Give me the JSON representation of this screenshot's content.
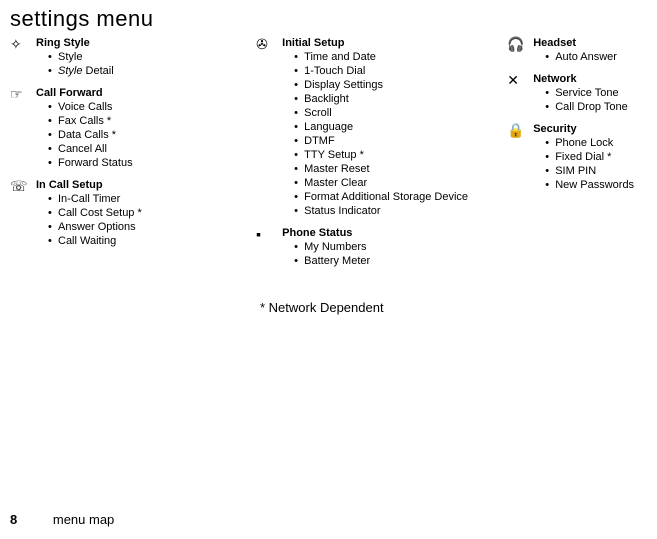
{
  "title": "settings menu",
  "footnote": "* Network Dependent",
  "footer": {
    "page": "8",
    "section": "menu map"
  },
  "columns": [
    {
      "sections": [
        {
          "icon": "✧",
          "icon_name": "ring-style-icon",
          "heading": "Ring Style",
          "items": [
            {
              "text": "Style"
            },
            {
              "prefix_italic": "Style",
              "suffix": " Detail"
            }
          ]
        },
        {
          "icon": "☞",
          "icon_name": "call-forward-icon",
          "heading": "Call Forward",
          "items": [
            {
              "text": "Voice Calls"
            },
            {
              "text": "Fax Calls *"
            },
            {
              "text": "Data Calls *"
            },
            {
              "text": "Cancel All"
            },
            {
              "text": "Forward Status"
            }
          ]
        },
        {
          "icon": "☏",
          "icon_name": "in-call-setup-icon",
          "heading": "In Call Setup",
          "items": [
            {
              "text": "In-Call Timer"
            },
            {
              "text": "Call Cost Setup *"
            },
            {
              "text": "Answer Options"
            },
            {
              "text": "Call Waiting"
            }
          ]
        }
      ]
    },
    {
      "sections": [
        {
          "icon": "✇",
          "icon_name": "initial-setup-icon",
          "heading": "Initial Setup",
          "items": [
            {
              "text": "Time and Date"
            },
            {
              "text": "1-Touch Dial"
            },
            {
              "text": "Display Settings"
            },
            {
              "text": "Backlight"
            },
            {
              "text": "Scroll"
            },
            {
              "text": "Language"
            },
            {
              "text": "DTMF"
            },
            {
              "text": "TTY Setup *"
            },
            {
              "text": "Master Reset"
            },
            {
              "text": "Master Clear"
            },
            {
              "text": "Format Additional Storage Device"
            },
            {
              "text": "Status Indicator"
            }
          ]
        },
        {
          "icon": "▪",
          "icon_name": "phone-status-icon",
          "heading": "Phone Status",
          "items": [
            {
              "text": "My Numbers"
            },
            {
              "text": "Battery Meter"
            }
          ]
        }
      ]
    },
    {
      "sections": [
        {
          "icon": "🎧",
          "icon_name": "headset-icon",
          "heading": "Headset",
          "items": [
            {
              "text": "Auto Answer"
            }
          ]
        },
        {
          "icon": "✕",
          "icon_name": "network-icon",
          "heading": "Network",
          "items": [
            {
              "text": "Service Tone"
            },
            {
              "text": "Call Drop Tone"
            }
          ]
        },
        {
          "icon": "🔒",
          "icon_name": "security-icon",
          "heading": "Security",
          "items": [
            {
              "text": "Phone Lock"
            },
            {
              "text": "Fixed Dial *"
            },
            {
              "text": "SIM PIN"
            },
            {
              "text": "New Passwords"
            }
          ]
        }
      ]
    }
  ]
}
